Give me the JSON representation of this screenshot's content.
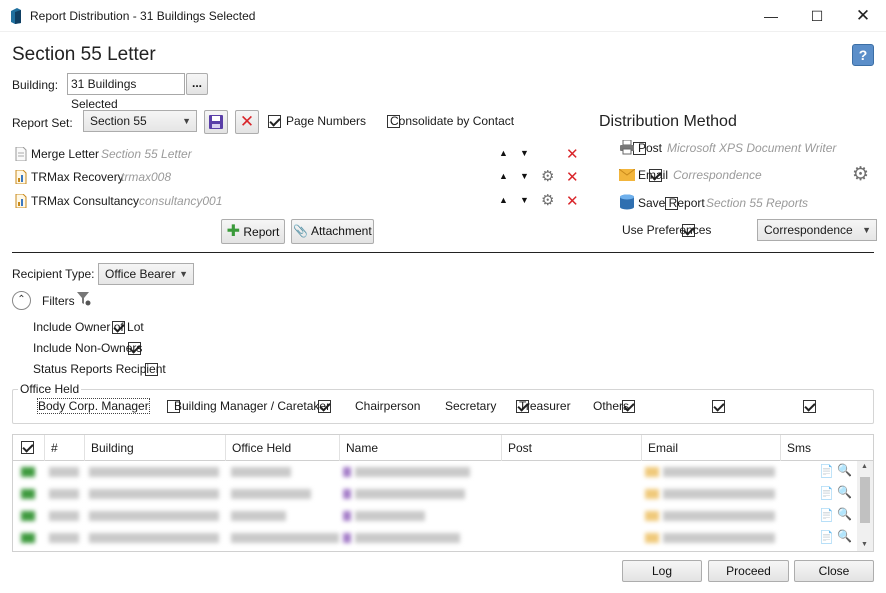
{
  "window": {
    "title": "Report Distribution - 31 Buildings Selected"
  },
  "heading": "Section 55 Letter",
  "building": {
    "label": "Building:",
    "value": "31 Buildings Selected",
    "browse_label": "..."
  },
  "report_set": {
    "label": "Report Set:",
    "value": "Section 55",
    "page_numbers_label": "Page Numbers",
    "page_numbers_checked": true,
    "consolidate_label": "Consolidate by Contact",
    "consolidate_checked": false
  },
  "reports": [
    {
      "name": "Merge Letter",
      "desc": "Section 55 Letter",
      "has_gear": false
    },
    {
      "name": "TRMax Recovery",
      "desc": "trmax008",
      "has_gear": true
    },
    {
      "name": "TRMax Consultancy",
      "desc": "consultancy001",
      "has_gear": true
    }
  ],
  "report_buttons": {
    "add_report": "Report",
    "add_attachment": "Attachment"
  },
  "distribution": {
    "title": "Distribution Method",
    "post": {
      "label": "Post",
      "desc": "Microsoft XPS Document Writer",
      "checked": false
    },
    "email": {
      "label": "Email",
      "desc": "Correspondence",
      "checked": true
    },
    "save": {
      "label": "Save Report",
      "desc": "Section 55 Reports",
      "checked": false
    },
    "use_prefs": {
      "label": "Use Preferences",
      "checked": true
    },
    "pref_value": "Correspondence"
  },
  "recipient": {
    "label": "Recipient Type:",
    "value": "Office Bearer"
  },
  "filters": {
    "label": "Filters",
    "include_owner": "Include Owner of Lot",
    "include_non_owners": "Include Non-Owners",
    "status_reports": "Status Reports Recipient",
    "office_held_title": "Office Held",
    "offices": [
      {
        "label": "Body Corp. Manager",
        "checked": false
      },
      {
        "label": "Building Manager / Caretaker",
        "checked": true
      },
      {
        "label": "Chairperson",
        "checked": true
      },
      {
        "label": "Secretary",
        "checked": true
      },
      {
        "label": "Treasurer",
        "checked": true
      },
      {
        "label": "Others",
        "checked": true
      }
    ]
  },
  "grid": {
    "columns": [
      "#",
      "Building",
      "Office Held",
      "Name",
      "Post",
      "Email",
      "Sms"
    ]
  },
  "footer": {
    "log": "Log",
    "proceed": "Proceed",
    "close": "Close"
  },
  "colors": {
    "accent": "#2b6cb0",
    "delete": "#d9262b",
    "email_icon": "#f2b53c"
  }
}
